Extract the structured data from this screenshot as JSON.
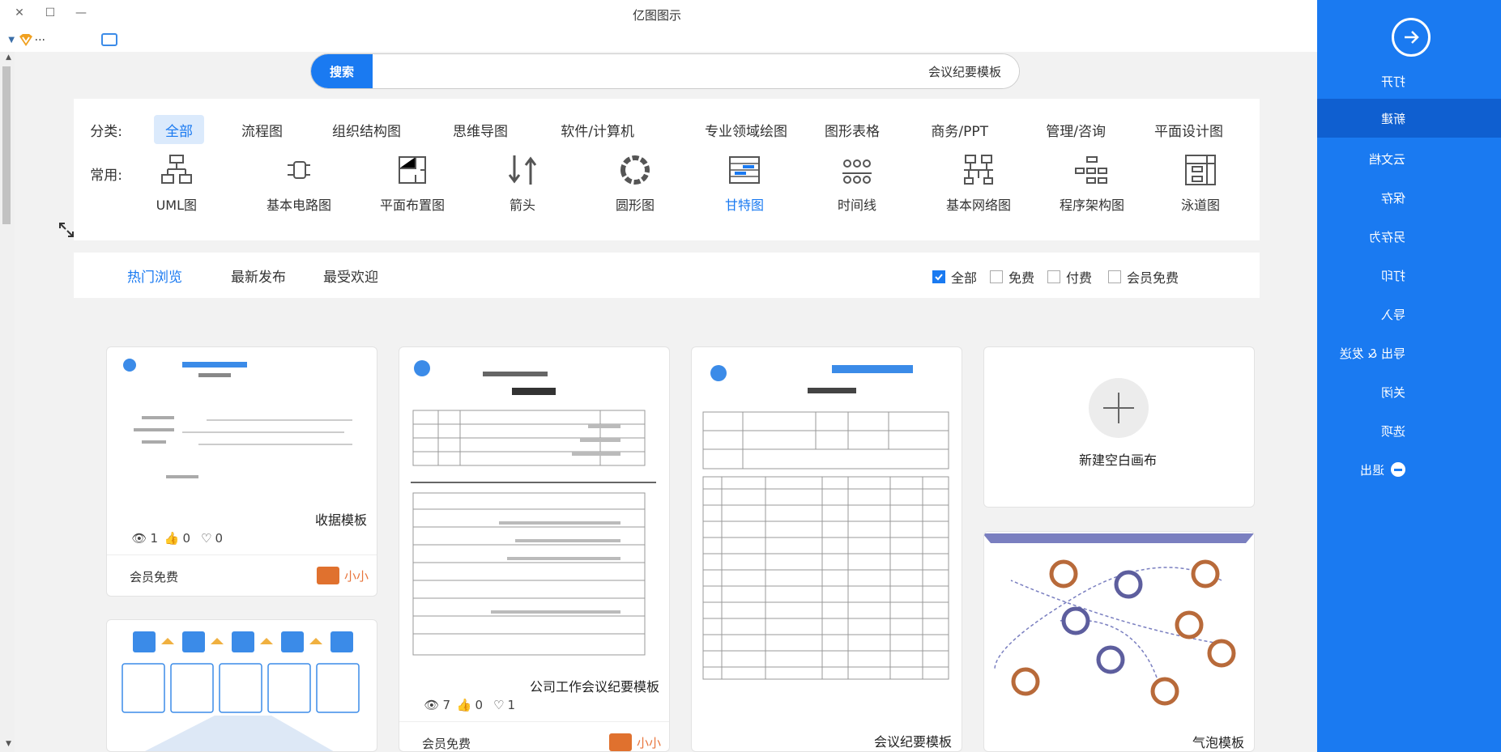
{
  "sidebar": {
    "items": [
      {
        "label": "打开"
      },
      {
        "label": "新建"
      },
      {
        "label": "云文档"
      },
      {
        "label": "保存"
      },
      {
        "label": "另存为"
      },
      {
        "label": "打印"
      },
      {
        "label": "导入"
      },
      {
        "label": "导出 & 发送"
      },
      {
        "label": "关闭"
      },
      {
        "label": "选项"
      },
      {
        "label": "退出"
      }
    ]
  },
  "window": {
    "title": "亿图图示",
    "toolbar_more": "..."
  },
  "search": {
    "value": "会议纪要模板",
    "button": "搜索"
  },
  "categories": {
    "label": "分类:",
    "items": [
      "全部",
      "流程图",
      "组织结构图",
      "思维导图",
      "软件/计算机",
      "专业领域绘图",
      "图形表格",
      "商务/PPT",
      "管理/咨询",
      "平面设计图"
    ]
  },
  "common": {
    "label": "常用:",
    "items": [
      "UML图",
      "基本电路图",
      "平面布置图",
      "箭头",
      "圆形图",
      "甘特图",
      "时间线",
      "基本网络图",
      "程序架构图",
      "泳道图"
    ]
  },
  "sort": {
    "tabs": [
      "热门浏览",
      "最新发布",
      "最受欢迎"
    ]
  },
  "filters": {
    "options": [
      "全部",
      "免费",
      "付费",
      "会员免费"
    ]
  },
  "cards": {
    "blank": {
      "title": "新建空白画布"
    },
    "meeting_a": {
      "title": "会议纪要模板"
    },
    "meeting_b": {
      "title": "公司工作会议纪要模板",
      "views": "7",
      "likes": "0",
      "favs": "1",
      "author": "小小",
      "price": "会员免费"
    },
    "receipt": {
      "title": "收据模板",
      "views": "1",
      "likes": "0",
      "favs": "0",
      "author": "小小",
      "price": "会员免费"
    },
    "bubble": {
      "title": "气泡模板"
    }
  },
  "colors": {
    "accent": "#1a7af1",
    "sidebar": "#1a7af1",
    "sidebar_active": "#0f5fd0"
  }
}
